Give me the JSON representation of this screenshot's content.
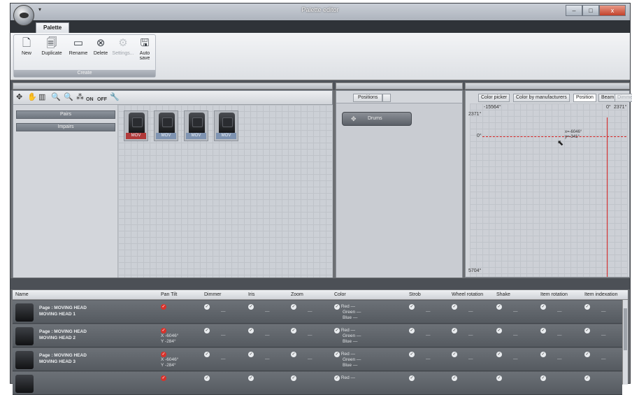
{
  "window": {
    "title": "Palette editor",
    "min": "–",
    "max": "□",
    "close": "x"
  },
  "ribbon": {
    "tab": "Palette",
    "group_label": "Create",
    "buttons": [
      {
        "label": "New",
        "icon": "new-document-icon"
      },
      {
        "label": "Duplicate",
        "icon": "duplicate-icon"
      },
      {
        "label": "Rename",
        "icon": "rename-icon"
      },
      {
        "label": "Delete",
        "icon": "delete-icon"
      },
      {
        "label": "Settings...",
        "icon": "settings-icon",
        "disabled": true
      },
      {
        "label": "Auto save",
        "icon": "auto-save-icon"
      }
    ]
  },
  "left_toolbar": {
    "on": "ON",
    "off": "OFF"
  },
  "groups": [
    "Pairs",
    "Impairs"
  ],
  "fixtures": [
    {
      "label": "MOV",
      "selected": true
    },
    {
      "label": "MOV",
      "selected": false
    },
    {
      "label": "MOV",
      "selected": false
    },
    {
      "label": "MOV",
      "selected": false
    }
  ],
  "positions": {
    "tab": "Positions",
    "preset": "Drums"
  },
  "position_panel": {
    "tabs": [
      "Color picker",
      "Color by manufacturers",
      "Position",
      "Beam",
      "Dimmer"
    ],
    "active_tab": "Position",
    "top_left": "-15564°",
    "top_right": "0°",
    "top_right2": "2371°",
    "left_top": "2371°",
    "left_mid": "0°",
    "left_bottom": "5704°",
    "cursor_x": "x=-6046°",
    "cursor_y": "y=-341°"
  },
  "table": {
    "headers": [
      "Name",
      "Pan Tilt",
      "Dimmer",
      "Iris",
      "Zoom",
      "Color",
      "Strob",
      "Wheel rotation",
      "Shake",
      "Item rotation",
      "Item indexation"
    ],
    "rows": [
      {
        "name1": "Page : MOVING HEAD",
        "name2": "MOVING HEAD 1",
        "pan_x": "",
        "pan_y": "",
        "red": "Red —",
        "green": "Green —",
        "blue": "Blue —"
      },
      {
        "name1": "Page : MOVING HEAD",
        "name2": "MOVING HEAD 2",
        "pan_x": "X -6046°",
        "pan_y": "Y -284°",
        "red": "Red —",
        "green": "Green —",
        "blue": "Blue —"
      },
      {
        "name1": "Page : MOVING HEAD",
        "name2": "MOVING HEAD 3",
        "pan_x": "X -6046°",
        "pan_y": "Y -284°",
        "red": "Red —",
        "green": "Green —",
        "blue": "Blue —"
      },
      {
        "name1": "",
        "name2": "",
        "pan_x": "",
        "pan_y": "",
        "red": "Red —",
        "green": "",
        "blue": ""
      }
    ],
    "dash": "—"
  }
}
